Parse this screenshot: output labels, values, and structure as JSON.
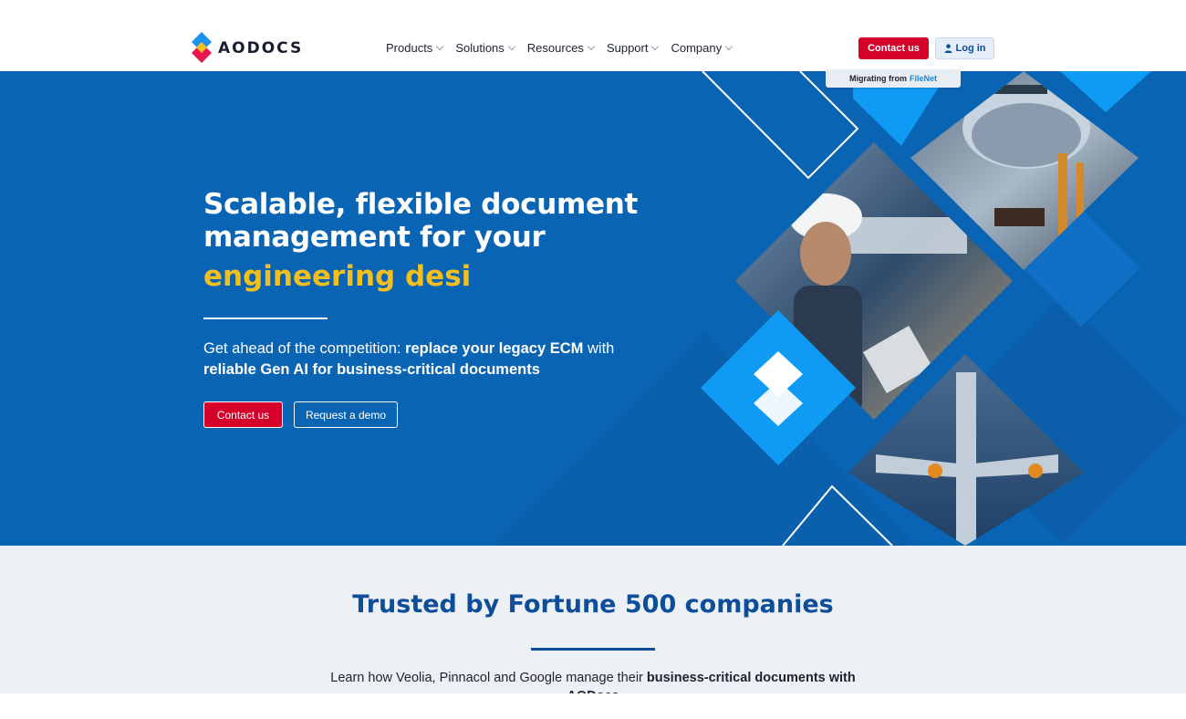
{
  "brand": {
    "name": "AODOCS",
    "colors": {
      "primary_blue": "#0a64b4",
      "accent_red": "#d4002a",
      "accent_yellow": "#f4be1c",
      "dark_blue": "#0c4e9a",
      "light_blue": "#0f9bf4"
    }
  },
  "nav": {
    "items": [
      {
        "label": "Products"
      },
      {
        "label": "Solutions"
      },
      {
        "label": "Resources"
      },
      {
        "label": "Support"
      },
      {
        "label": "Company"
      }
    ],
    "contact_label": "Contact us",
    "login_label": "Log in",
    "login_icon": "user-icon",
    "migrate_prefix": "Migrating from",
    "migrate_highlight": "FileNet"
  },
  "hero": {
    "title_line1": "Scalable, flexible document",
    "title_line2": "management for your",
    "typed_text": "engineering desi",
    "subtitle_part1": "Get ahead of the competition: ",
    "subtitle_bold1": "replace your legacy ECM",
    "subtitle_part2": " with ",
    "subtitle_bold2": "reliable Gen AI for business-critical documents",
    "cta_contact": "Contact us",
    "cta_demo": "Request a demo",
    "images": [
      "aircraft-hangar-photo",
      "engineer-with-tablet-photo",
      "aircraft-assembly-line-photo"
    ]
  },
  "trusted": {
    "title": "Trusted by Fortune 500 companies",
    "subtitle_part1": "Learn how Veolia, Pinnacol and Google manage their ",
    "subtitle_bold": "business-critical documents with AODocs"
  }
}
